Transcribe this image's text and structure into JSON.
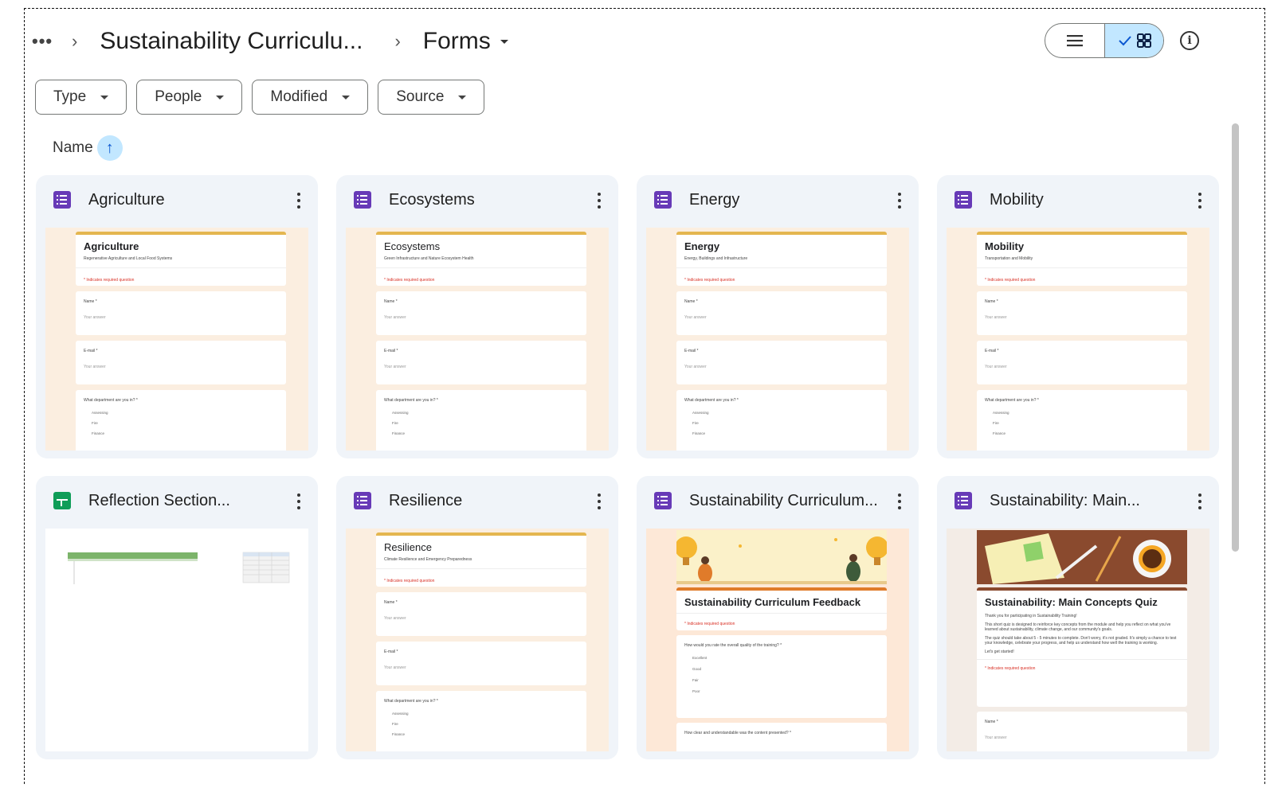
{
  "breadcrumb": {
    "more": "•••",
    "separator": "›",
    "parent": "Sustainability Curriculu...",
    "current": "Forms"
  },
  "view_toggle": {
    "list_icon": "list-icon",
    "grid_icon": "grid-icon",
    "active": "grid"
  },
  "info_icon": "i",
  "filters": [
    "Type",
    "People",
    "Modified",
    "Source"
  ],
  "sort": {
    "label": "Name",
    "arrow": "↑",
    "direction": "ascending"
  },
  "colors": {
    "accent": "#c2e7ff",
    "forms": "#673ab7",
    "sheets": "#0f9d58",
    "header_bar": "#e4b64f"
  },
  "files": [
    {
      "title": "Agriculture",
      "type": "forms",
      "preview": {
        "title": "Agriculture",
        "subtitle": "Regenerative Agriculture and Local Food Systems",
        "required": "* Indicates required question",
        "q1": "Name *",
        "a1": "Your answer",
        "q2": "E-mail *",
        "a2": "Your answer",
        "q3": "What department are you in? *",
        "options": [
          "Assessing",
          "Fire",
          "Finance"
        ]
      }
    },
    {
      "title": "Ecosystems",
      "type": "forms",
      "preview": {
        "title": "Ecosystems",
        "subtitle": "Green Infrastructure and Nature Ecosystem Health",
        "required": "* Indicates required question",
        "q1": "Name *",
        "a1": "Your answer",
        "q2": "E-mail *",
        "a2": "Your answer",
        "q3": "What department are you in? *",
        "options": [
          "Assessing",
          "Fire",
          "Finance"
        ]
      }
    },
    {
      "title": "Energy",
      "type": "forms",
      "preview": {
        "title": "Energy",
        "subtitle": "Energy, Buildings and Infrastructure",
        "required": "* Indicates required question",
        "q1": "Name *",
        "a1": "Your answer",
        "q2": "E-mail *",
        "a2": "Your answer",
        "q3": "What department are you in? *",
        "options": [
          "Assessing",
          "Fire",
          "Finance"
        ]
      }
    },
    {
      "title": "Mobility",
      "type": "forms",
      "preview": {
        "title": "Mobility",
        "subtitle": "Transportation and Mobility",
        "required": "* Indicates required question",
        "q1": "Name *",
        "a1": "Your answer",
        "q2": "E-mail *",
        "a2": "Your answer",
        "q3": "What department are you in? *",
        "options": [
          "Assessing",
          "Fire",
          "Finance"
        ]
      }
    },
    {
      "title": "Reflection Section...",
      "type": "sheets"
    },
    {
      "title": "Resilience",
      "type": "forms",
      "preview": {
        "title": "Resilience",
        "subtitle": "Climate Resilience and Emergency Preparedness",
        "required": "* Indicates required question",
        "q1": "Name *",
        "a1": "Your answer",
        "q2": "E-mail *",
        "a2": "Your answer",
        "q3": "What department are you in? *",
        "options": [
          "Assessing",
          "Fire",
          "Finance"
        ]
      }
    },
    {
      "title": "Sustainability Curriculum...",
      "type": "forms",
      "preview": {
        "title": "Sustainability Curriculum Feedback",
        "required": "* Indicates required question",
        "q1": "How would you rate the overall quality of the training? *",
        "options": [
          "Excellent",
          "Good",
          "Fair",
          "Poor"
        ],
        "q2": "How clear and understandable was the content presented? *"
      }
    },
    {
      "title": "Sustainability: Main...",
      "type": "forms",
      "preview": {
        "title": "Sustainability: Main Concepts Quiz",
        "p1": "Thank you for participating in Sustainability Training!",
        "p2": "This short quiz is designed to reinforce key concepts from the module and help you reflect on what you've learned about sustainability, climate change, and our community's goals.",
        "p3": "The quiz should take about 5 - 5 minutes to complete. Don't worry, it's not graded. It's simply a chance to test your knowledge, celebrate your progress, and help us understand how well the training is working.",
        "p4": "Let's get started!",
        "required": "* Indicates required question",
        "q1": "Name *",
        "a1": "Your answer"
      }
    }
  ]
}
